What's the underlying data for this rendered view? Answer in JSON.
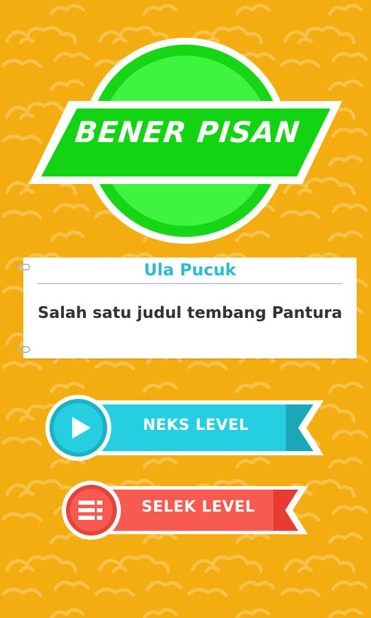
{
  "colors": {
    "background": "#F3AD10",
    "pattern": "#F6BE3B",
    "badge_green": "#3BF53B",
    "badge_banner": "#11D411",
    "card_title": "#2DBBD2",
    "next_button": "#25CEE0",
    "next_button_dark": "#1BA7BA",
    "select_button": "#F95A4F",
    "select_button_dark": "#E83C33"
  },
  "badge": {
    "label": "BENER PISAN"
  },
  "card": {
    "title": "Ula Pucuk",
    "body": "Salah satu judul tembang Pantura"
  },
  "buttons": {
    "next_label": "NEKS LEVEL",
    "next_icon": "play-icon",
    "select_label": "SELEK LEVEL",
    "select_icon": "level-list-icon"
  }
}
